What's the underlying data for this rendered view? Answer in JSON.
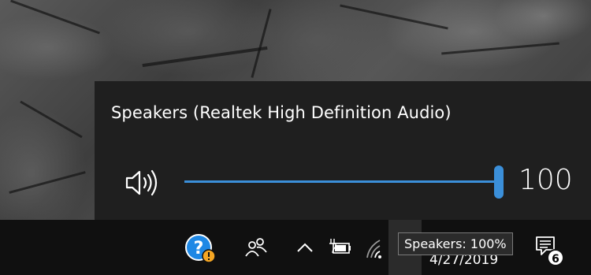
{
  "volume_flyout": {
    "device_name": "Speakers (Realtek High Definition Audio)",
    "volume_value": "100",
    "volume_level_fraction": 1.0,
    "accent_color": "#3b8fd9"
  },
  "taskbar": {
    "tooltip": "Speakers: 100%",
    "date": "4/27/2019",
    "notification_count": "6",
    "icons": [
      "help-icon",
      "people-icon",
      "show-hidden-icons-chevron",
      "power-battery-icon",
      "network-icon",
      "volume-icon",
      "action-center-icon"
    ]
  }
}
